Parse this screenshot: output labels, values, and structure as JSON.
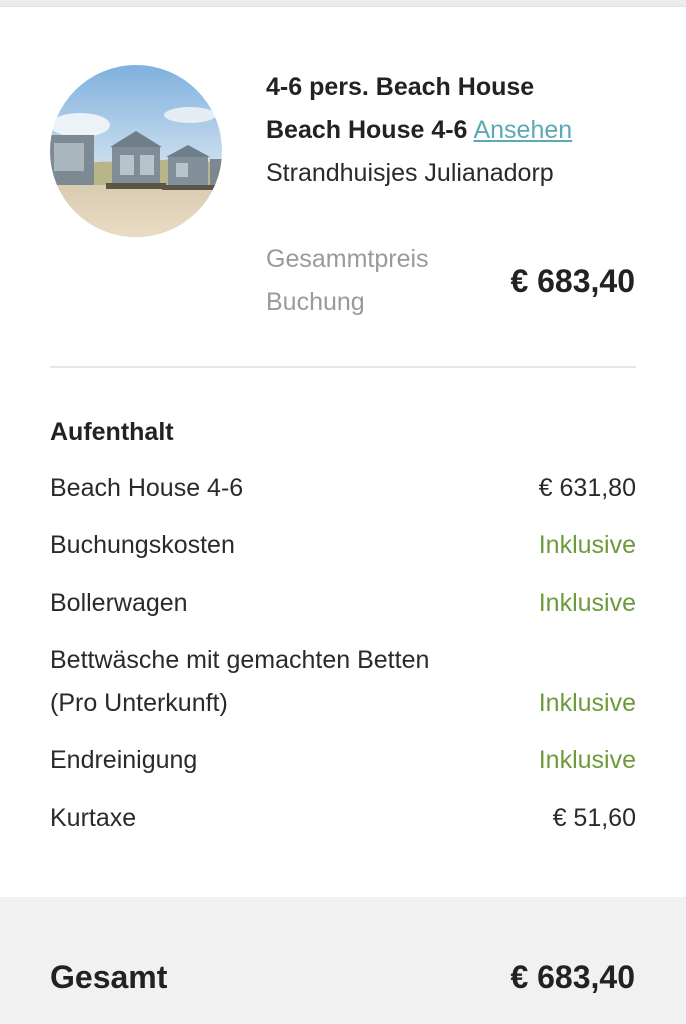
{
  "listing": {
    "title": "4-6 pers. Beach House",
    "unit_name": "Beach House 4-6",
    "view_link": "Ansehen",
    "park_name": "Strandhuisjes Julianadorp",
    "total_label_line1": "Gesammtpreis",
    "total_label_line2": "Buchung",
    "total_price": "€ 683,40",
    "image_icon": "beach-house-photo"
  },
  "stay": {
    "heading": "Aufenthalt",
    "items": [
      {
        "name": "Beach House 4-6",
        "amount": "€ 631,80",
        "included": false
      },
      {
        "name": "Buchungskosten",
        "amount": "Inklusive",
        "included": true
      },
      {
        "name": "Bollerwagen",
        "amount": "Inklusive",
        "included": true
      },
      {
        "name_line1": "Bettwäsche mit gemachten Betten",
        "name_line2": "(Pro Unterkunft)",
        "amount": "Inklusive",
        "included": true
      },
      {
        "name": "Endreinigung",
        "amount": "Inklusive",
        "included": true
      },
      {
        "name": "Kurtaxe",
        "amount": "€ 51,60",
        "included": false
      }
    ]
  },
  "footer": {
    "label": "Gesamt",
    "total": "€ 683,40"
  },
  "colors": {
    "link": "#5aa9b5",
    "included": "#6d9a3c",
    "muted": "#9a9a9a",
    "footer_bg": "#f1f1f1"
  }
}
